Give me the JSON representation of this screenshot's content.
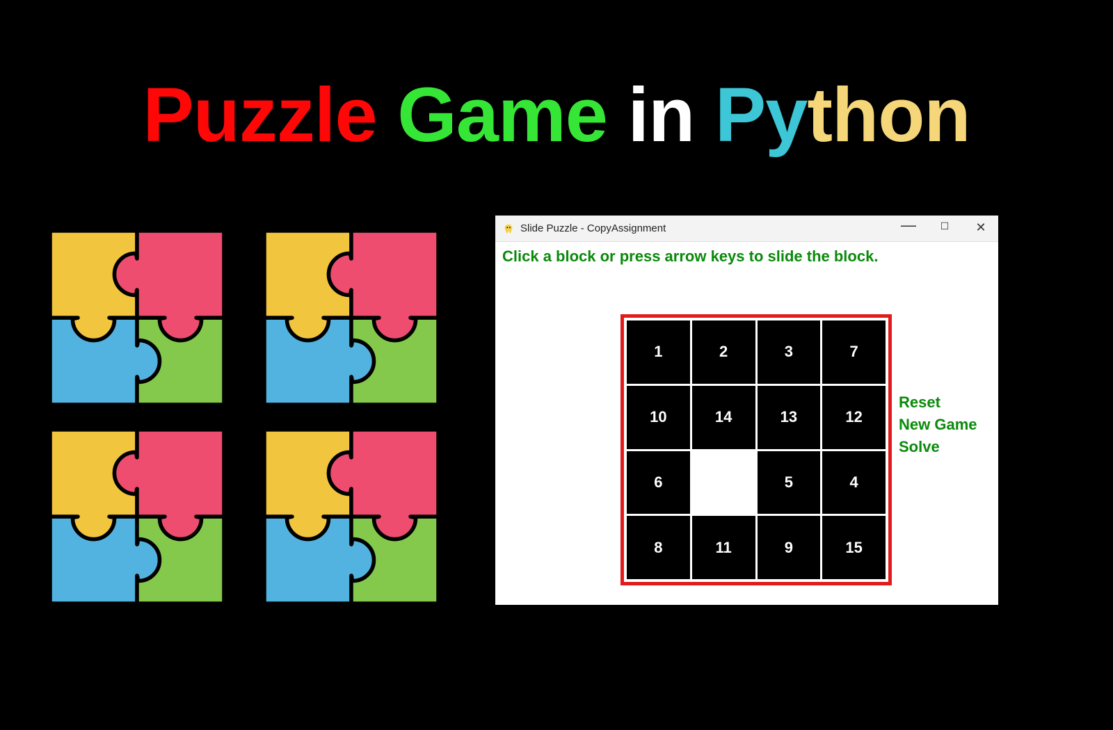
{
  "title": {
    "w1": "Puzzle",
    "w2": "Game",
    "w3": "in",
    "w4a": "Py",
    "w4b": "thon"
  },
  "puzzle_icon": {
    "colors": {
      "yellow": "#f2c53f",
      "pink": "#ee4d70",
      "blue": "#53b3e0",
      "green": "#84c94b",
      "stroke": "#000000"
    },
    "name": "jigsaw-four-piece-icon"
  },
  "window": {
    "title": "Slide Puzzle - CopyAssignment",
    "controls": {
      "minimize": "—",
      "maximize": "☐",
      "close": "✕"
    },
    "instruction": "Click a block or press arrow keys to slide the block.",
    "actions": {
      "reset": "Reset",
      "new_game": "New Game",
      "solve": "Solve"
    },
    "board": {
      "rows": 4,
      "cols": 4,
      "tiles": [
        [
          "1",
          "2",
          "3",
          "7"
        ],
        [
          "10",
          "14",
          "13",
          "12"
        ],
        [
          "6",
          "",
          "5",
          "4"
        ],
        [
          "8",
          "11",
          "9",
          "15"
        ]
      ]
    },
    "colors": {
      "border": "#e21a1a",
      "text_green": "#0a8a0a"
    }
  }
}
